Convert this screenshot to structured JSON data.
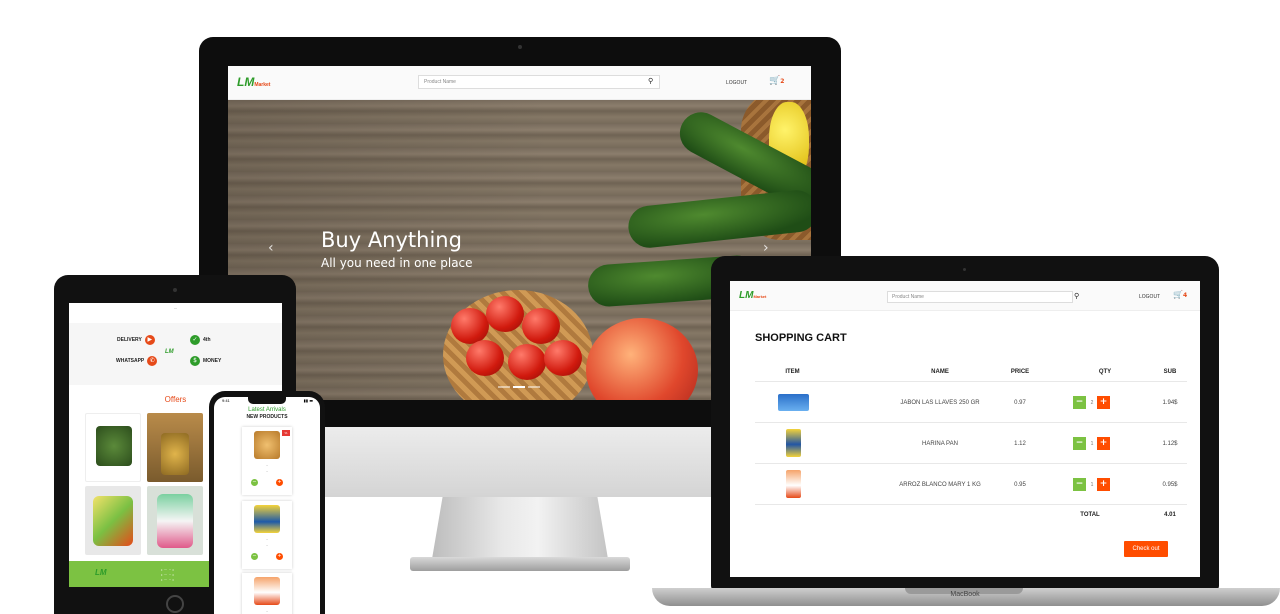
{
  "colors": {
    "brand_green": "#2e9c2a",
    "accent_orange": "#e64a19",
    "checkout_orange": "#ff4d00",
    "qty_minus": "#7cc242",
    "qty_plus": "#ff4d00"
  },
  "imac": {
    "logo_text": "LM",
    "logo_tag": "Market",
    "search_placeholder": "Product Name",
    "search_icon": "search-icon",
    "nav_logout": "LOGOUT",
    "cart_count": "2",
    "hero": {
      "title": "Buy Anything",
      "subtitle": "All you need in one place",
      "prev": "‹",
      "next": "›"
    }
  },
  "ipad": {
    "top_text": "...",
    "services": [
      {
        "title": "DELIVERY",
        "icon": "truck-icon"
      },
      {
        "title": "WHATSAPP",
        "icon": "whatsapp-icon"
      },
      {
        "title": "4th",
        "icon": "check-icon"
      },
      {
        "title": "MONEY",
        "icon": "money-icon"
      }
    ],
    "offers_title": "Offers",
    "footer_logo": "LM"
  },
  "iphone": {
    "time": "9:41",
    "header": "Latest Arrivals",
    "subheader": "NEW PRODUCTS",
    "cards": [
      {
        "name": "...",
        "price": "..."
      },
      {
        "name": "...",
        "price": "..."
      },
      {
        "name": "...",
        "price": "..."
      }
    ]
  },
  "macbook": {
    "logo_text": "LM",
    "logo_tag": "Market",
    "search_placeholder": "Product Name",
    "nav_logout": "LOGOUT",
    "cart_count": "4",
    "cart_title": "SHOPPING CART",
    "columns": [
      "ITEM",
      "NAME",
      "PRICE",
      "QTY",
      "SUB"
    ],
    "rows": [
      {
        "name": "JABON LAS LLAVES 250 GR",
        "price": "0.97",
        "qty": "2",
        "sub": "1.94$"
      },
      {
        "name": "HARINA PAN",
        "price": "1.12",
        "qty": "1",
        "sub": "1.12$"
      },
      {
        "name": "ARROZ BLANCO MARY 1 KG",
        "price": "0.95",
        "qty": "1",
        "sub": "0.95$"
      }
    ],
    "total_label": "TOTAL",
    "total_value": "4.01",
    "checkout_label": "Check out",
    "brand_label": "MacBook"
  }
}
